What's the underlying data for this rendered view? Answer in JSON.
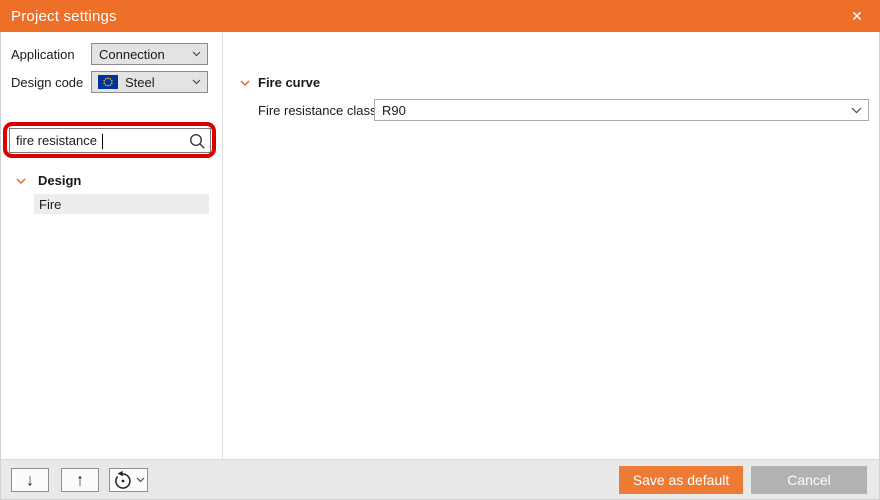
{
  "titlebar": {
    "title": "Project settings",
    "close_icon": "✕"
  },
  "sidebar": {
    "application": {
      "label": "Application",
      "value": "Connection"
    },
    "design_code": {
      "label": "Design code",
      "value": "Steel",
      "flag_icon": "eu-flag"
    },
    "search": {
      "value": "fire resistance",
      "icon": "magnifier"
    },
    "tree": {
      "group_label": "Design",
      "items": [
        {
          "label": "Fire",
          "selected": true
        }
      ]
    }
  },
  "main": {
    "section_title": "Fire curve",
    "fields": [
      {
        "label": "Fire resistance class",
        "value": "R90"
      }
    ]
  },
  "footer": {
    "move_down_icon": "↓",
    "move_up_icon": "↑",
    "undo_icon": "rotate-ccw",
    "save_label": "Save as default",
    "cancel_label": "Cancel"
  },
  "colors": {
    "accent_orange": "#ee6f28",
    "save_button_orange": "#ee7b35",
    "cancel_gray": "#b2b2b2",
    "annotation_red": "#dc0000",
    "selection_gray": "#ededed"
  }
}
